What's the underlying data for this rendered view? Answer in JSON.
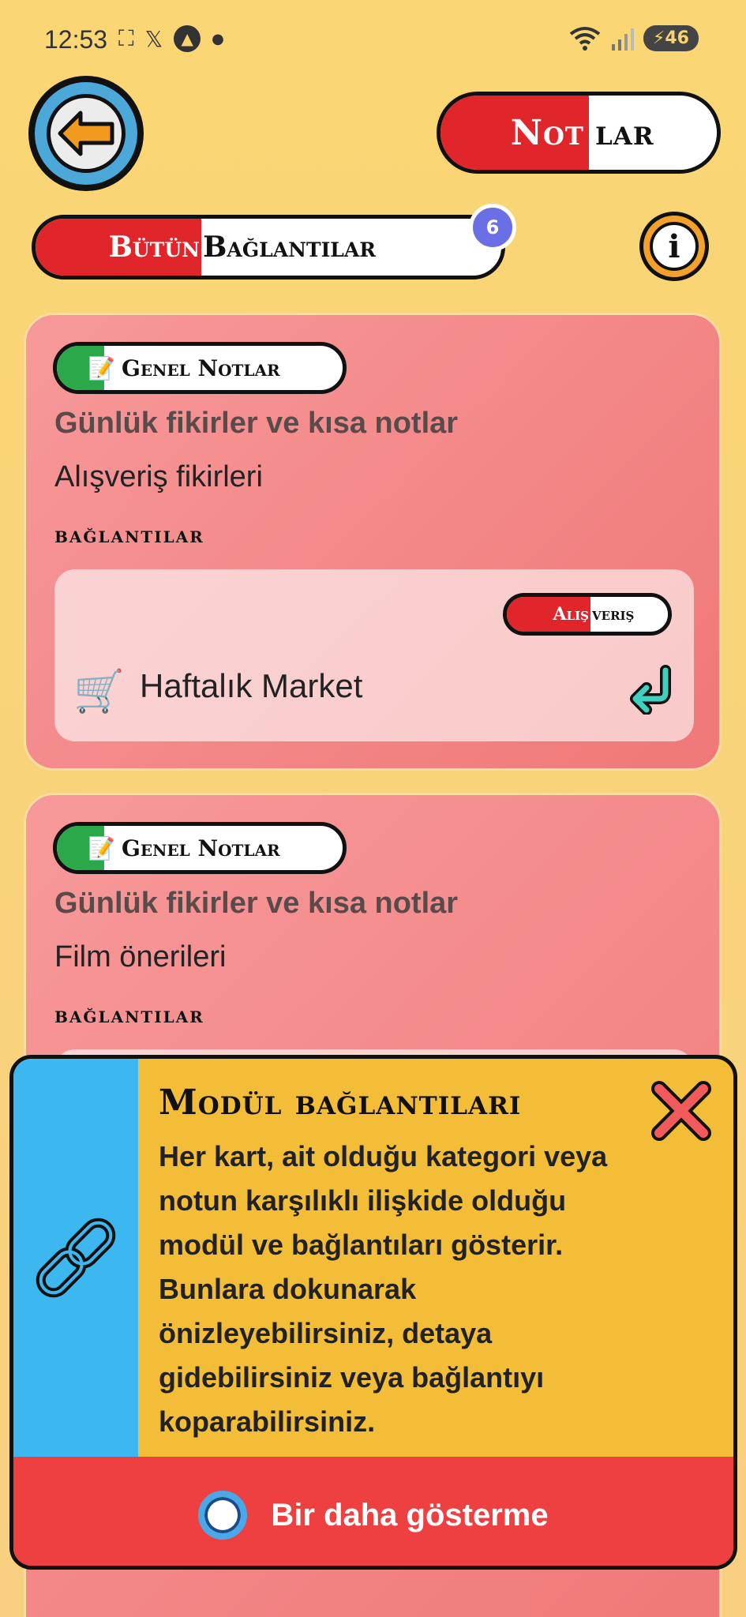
{
  "status_bar": {
    "time": "12:53",
    "battery": "46"
  },
  "header": {
    "title_left": "Not",
    "title_right": "lar"
  },
  "filter": {
    "left": "Bütün",
    "right": "Bağlantılar",
    "count": "6"
  },
  "cards": [
    {
      "category": "Genel Notlar",
      "subtitle": "Günlük fikirler ve kısa notlar",
      "note": "Alışveriş fikirleri",
      "section_label": "bağlantılar",
      "link_tag_left": "Alış",
      "link_tag_right": "veriş",
      "link_title": "Haftalık Market"
    },
    {
      "category": "Genel Notlar",
      "subtitle": "Günlük fikirler ve kısa notlar",
      "note": "Film önerileri",
      "section_label": "bağlantılar"
    }
  ],
  "info_panel": {
    "title": "Modül bağlantıları",
    "body": "Her kart, ait olduğu kategori veya notun karşılıklı ilişkide olduğu modül ve bağlantıları gösterir. Bunlara dokunarak önizleyebilirsiniz, detaya gidebilirsiniz veya bağlantıyı koparabilirsiniz.",
    "dont_show": "Bir daha gösterme"
  },
  "colors": {
    "background": "#fad674",
    "accent_red": "#e0252b",
    "card": "#f28a8a",
    "panel": "#f4bd38",
    "panel_side": "#3db7f0",
    "panel_bottom": "#ee4040"
  },
  "icons": [
    "back-arrow-icon",
    "info-icon",
    "note-icon",
    "cart-icon",
    "return-icon",
    "chain-link-icon",
    "close-icon"
  ]
}
